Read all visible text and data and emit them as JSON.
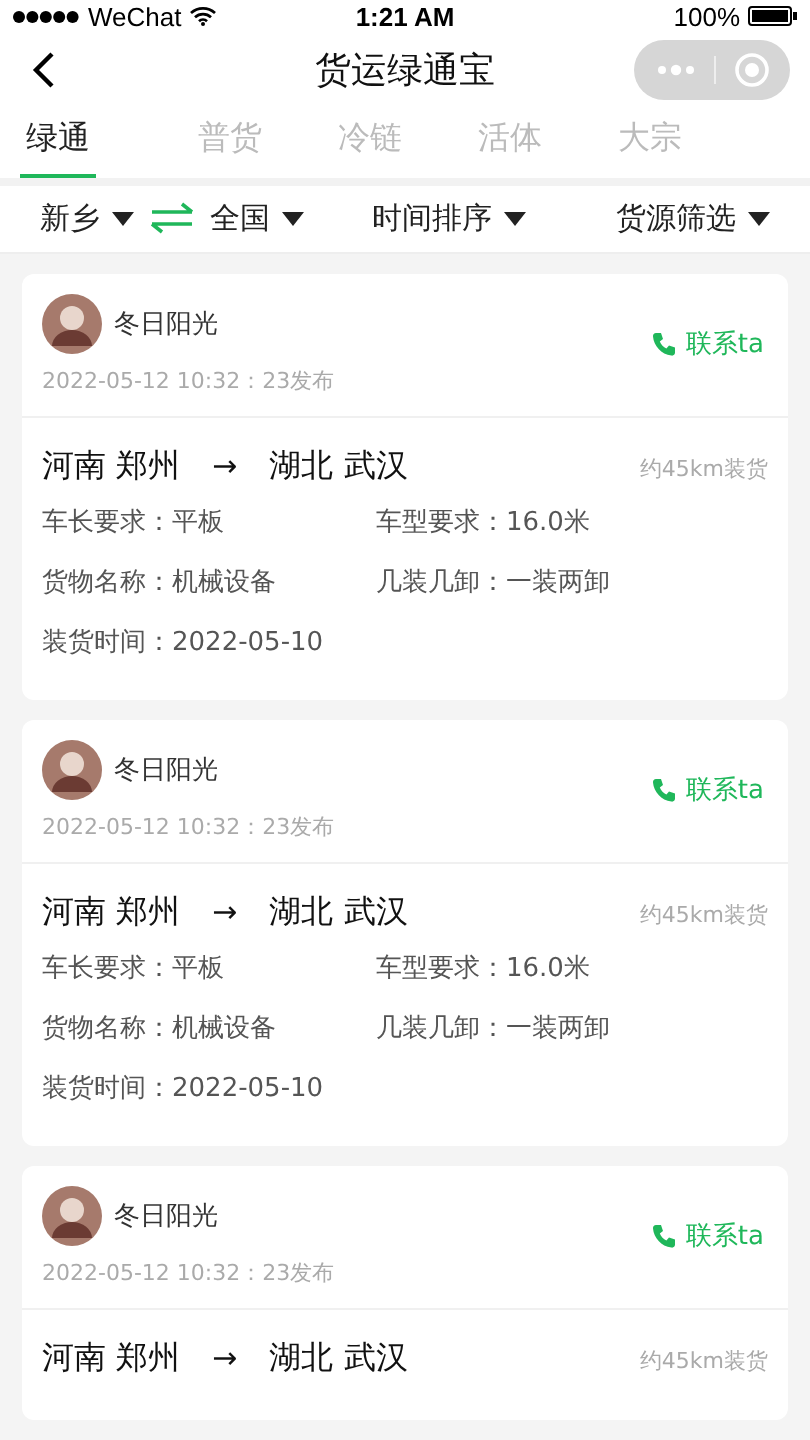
{
  "status_bar": {
    "carrier": "WeChat",
    "time": "1:21 AM",
    "battery": "100%"
  },
  "nav": {
    "title": "货运绿通宝"
  },
  "tabs": [
    {
      "label": "绿通",
      "selected": true
    },
    {
      "label": "普货",
      "selected": false
    },
    {
      "label": "冷链",
      "selected": false
    },
    {
      "label": "活体",
      "selected": false
    },
    {
      "label": "大宗",
      "selected": false
    }
  ],
  "filters": {
    "from": "新乡",
    "to": "全国",
    "sort": "时间排序",
    "source": "货源筛选"
  },
  "listings": [
    {
      "user": "冬日阳光",
      "posted": "2022-05-12 10:32：23发布",
      "contact": "联系ta",
      "from": "河南 郑州",
      "arrow": "→",
      "to": "湖北 武汉",
      "distance": "约45km装货",
      "fields": [
        {
          "label": "车长要求：",
          "value": "平板"
        },
        {
          "label": "车型要求：",
          "value": "16.0米"
        },
        {
          "label": "货物名称：",
          "value": "机械设备"
        },
        {
          "label": "几装几卸：",
          "value": "一装两卸"
        },
        {
          "label": "装货时间：",
          "value": "2022-05-10"
        }
      ]
    },
    {
      "user": "冬日阳光",
      "posted": "2022-05-12 10:32：23发布",
      "contact": "联系ta",
      "from": "河南 郑州",
      "arrow": "→",
      "to": "湖北 武汉",
      "distance": "约45km装货",
      "fields": [
        {
          "label": "车长要求：",
          "value": "平板"
        },
        {
          "label": "车型要求：",
          "value": "16.0米"
        },
        {
          "label": "货物名称：",
          "value": "机械设备"
        },
        {
          "label": "几装几卸：",
          "value": "一装两卸"
        },
        {
          "label": "装货时间：",
          "value": "2022-05-10"
        }
      ]
    },
    {
      "user": "冬日阳光",
      "posted": "2022-05-12 10:32：23发布",
      "contact": "联系ta",
      "from": "河南 郑州",
      "arrow": "→",
      "to": "湖北 武汉",
      "distance": "约45km装货"
    }
  ]
}
